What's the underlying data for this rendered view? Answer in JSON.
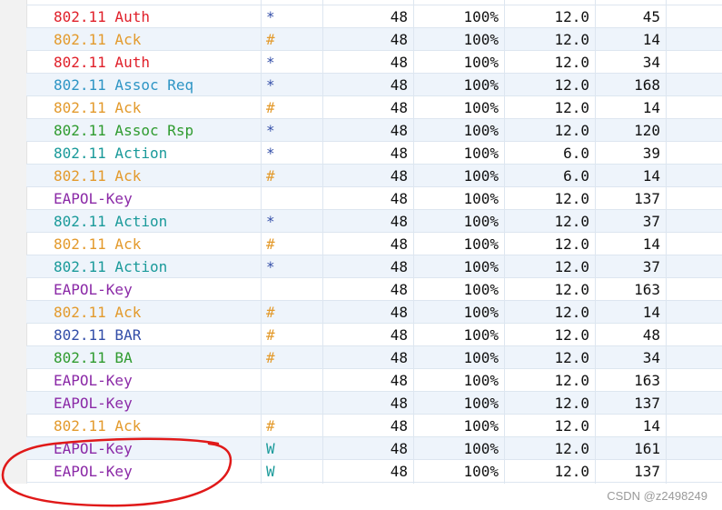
{
  "colors": {
    "auth": "#e0202a",
    "ack": "#e39a2c",
    "assoc_req": "#2e95c5",
    "assoc_rsp": "#2f9b2f",
    "action": "#1a9a9a",
    "eapol": "#8b2aa7",
    "bar": "#334ea8",
    "ba": "#2f9b2f",
    "annotation": "#e01919"
  },
  "rows": [
    {
      "name": "802.11 Auth",
      "flag": "*",
      "len": "48",
      "pct": "100%",
      "rate": "12.0",
      "size": "45",
      "color": "#e0202a",
      "flag_color": "#334ea8"
    },
    {
      "name": "802.11 Ack",
      "flag": "#",
      "len": "48",
      "pct": "100%",
      "rate": "12.0",
      "size": "14",
      "color": "#e39a2c",
      "flag_color": "#e39a2c"
    },
    {
      "name": "802.11 Auth",
      "flag": "*",
      "len": "48",
      "pct": "100%",
      "rate": "12.0",
      "size": "34",
      "color": "#e0202a",
      "flag_color": "#334ea8"
    },
    {
      "name": "802.11 Assoc Req",
      "flag": "*",
      "len": "48",
      "pct": "100%",
      "rate": "12.0",
      "size": "168",
      "color": "#2e95c5",
      "flag_color": "#334ea8"
    },
    {
      "name": "802.11 Ack",
      "flag": "#",
      "len": "48",
      "pct": "100%",
      "rate": "12.0",
      "size": "14",
      "color": "#e39a2c",
      "flag_color": "#e39a2c"
    },
    {
      "name": "802.11 Assoc Rsp",
      "flag": "*",
      "len": "48",
      "pct": "100%",
      "rate": "12.0",
      "size": "120",
      "color": "#2f9b2f",
      "flag_color": "#334ea8"
    },
    {
      "name": "802.11 Action",
      "flag": "*",
      "len": "48",
      "pct": "100%",
      "rate": "6.0",
      "size": "39",
      "color": "#1a9a9a",
      "flag_color": "#334ea8"
    },
    {
      "name": "802.11 Ack",
      "flag": "#",
      "len": "48",
      "pct": "100%",
      "rate": "6.0",
      "size": "14",
      "color": "#e39a2c",
      "flag_color": "#e39a2c"
    },
    {
      "name": "EAPOL-Key",
      "flag": "",
      "len": "48",
      "pct": "100%",
      "rate": "12.0",
      "size": "137",
      "color": "#8b2aa7",
      "flag_color": "#334ea8"
    },
    {
      "name": "802.11 Action",
      "flag": "*",
      "len": "48",
      "pct": "100%",
      "rate": "12.0",
      "size": "37",
      "color": "#1a9a9a",
      "flag_color": "#334ea8"
    },
    {
      "name": "802.11 Ack",
      "flag": "#",
      "len": "48",
      "pct": "100%",
      "rate": "12.0",
      "size": "14",
      "color": "#e39a2c",
      "flag_color": "#e39a2c"
    },
    {
      "name": "802.11 Action",
      "flag": "*",
      "len": "48",
      "pct": "100%",
      "rate": "12.0",
      "size": "37",
      "color": "#1a9a9a",
      "flag_color": "#334ea8"
    },
    {
      "name": "EAPOL-Key",
      "flag": "",
      "len": "48",
      "pct": "100%",
      "rate": "12.0",
      "size": "163",
      "color": "#8b2aa7",
      "flag_color": "#334ea8"
    },
    {
      "name": "802.11 Ack",
      "flag": "#",
      "len": "48",
      "pct": "100%",
      "rate": "12.0",
      "size": "14",
      "color": "#e39a2c",
      "flag_color": "#e39a2c"
    },
    {
      "name": "802.11 BAR",
      "flag": "#",
      "len": "48",
      "pct": "100%",
      "rate": "12.0",
      "size": "48",
      "color": "#334ea8",
      "flag_color": "#e39a2c"
    },
    {
      "name": "802.11 BA",
      "flag": "#",
      "len": "48",
      "pct": "100%",
      "rate": "12.0",
      "size": "34",
      "color": "#2f9b2f",
      "flag_color": "#e39a2c"
    },
    {
      "name": "EAPOL-Key",
      "flag": "",
      "len": "48",
      "pct": "100%",
      "rate": "12.0",
      "size": "163",
      "color": "#8b2aa7",
      "flag_color": "#334ea8"
    },
    {
      "name": "EAPOL-Key",
      "flag": "",
      "len": "48",
      "pct": "100%",
      "rate": "12.0",
      "size": "137",
      "color": "#8b2aa7",
      "flag_color": "#334ea8"
    },
    {
      "name": "802.11 Ack",
      "flag": "#",
      "len": "48",
      "pct": "100%",
      "rate": "12.0",
      "size": "14",
      "color": "#e39a2c",
      "flag_color": "#e39a2c"
    },
    {
      "name": "EAPOL-Key",
      "flag": "W",
      "len": "48",
      "pct": "100%",
      "rate": "12.0",
      "size": "161",
      "color": "#8b2aa7",
      "flag_color": "#1a9a9a"
    },
    {
      "name": "EAPOL-Key",
      "flag": "W",
      "len": "48",
      "pct": "100%",
      "rate": "12.0",
      "size": "137",
      "color": "#8b2aa7",
      "flag_color": "#1a9a9a"
    }
  ],
  "watermark": "CSDN @z2498249"
}
